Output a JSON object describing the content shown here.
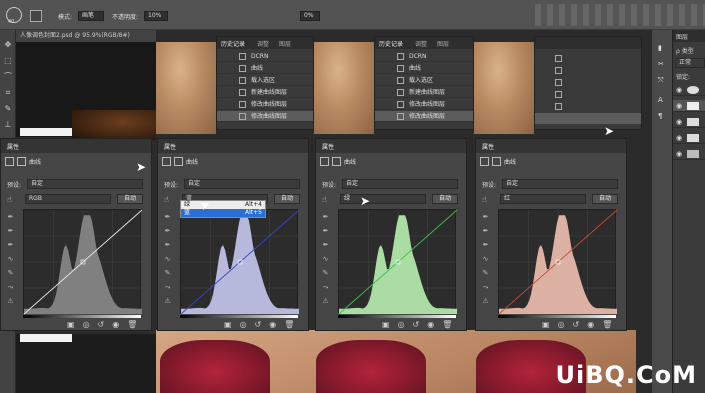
{
  "options_bar": {
    "brush_size": "40",
    "mode_label": "模式:",
    "mode_value": "画笔",
    "opacity_label": "不透明度:",
    "opacity_value": "10%",
    "smooth_value": "0%"
  },
  "document_tab": {
    "title": "人像调色封面2.psd @ 95.9%(RGB/8#)"
  },
  "history_panels": [
    {
      "tabs": [
        "历史记录",
        "调整",
        "图层"
      ],
      "rows": [
        "DCRN",
        "曲线",
        "载入选区",
        "新建曲线图层",
        "修改曲线图层",
        "修改曲线图层"
      ]
    },
    {
      "tabs": [
        "历史记录",
        "调整",
        "图层"
      ],
      "rows": [
        "DCRN",
        "曲线",
        "载入选区",
        "新建曲线图层",
        "修改曲线图层",
        "修改曲线图层"
      ]
    }
  ],
  "properties_panels": [
    {
      "header": "属性",
      "sub": "曲线",
      "preset_label": "预设:",
      "preset_value": "自定",
      "channel": "RGB",
      "auto": "自动",
      "curve_color": "#e8e8e8",
      "hist_color": "#8a8a8a"
    },
    {
      "header": "属性",
      "sub": "曲线",
      "preset_label": "预设:",
      "preset_value": "自定",
      "channel": "蓝",
      "auto": "自动",
      "curve_color": "#3646c8",
      "hist_color": "#c5c8f0"
    },
    {
      "header": "属性",
      "sub": "曲线",
      "preset_label": "预设:",
      "preset_value": "自定",
      "channel": "绿",
      "auto": "自动",
      "curve_color": "#3cc04a",
      "hist_color": "#b8f0b0"
    },
    {
      "header": "属性",
      "sub": "曲线",
      "preset_label": "预设:",
      "preset_value": "自定",
      "channel": "红",
      "auto": "自动",
      "curve_color": "#c84a3a",
      "hist_color": "#f0c0b0"
    }
  ],
  "channel_menu": {
    "items": [
      {
        "label": "绿",
        "shortcut": "Alt+4"
      },
      {
        "label": "蓝",
        "shortcut": "Alt+5"
      }
    ]
  },
  "right_panel": {
    "header": "图层",
    "kind_label": "ρ 类型",
    "blend_mode": "正常",
    "lock_label": "锁定:"
  },
  "watermark": "UiBQ.CoM"
}
